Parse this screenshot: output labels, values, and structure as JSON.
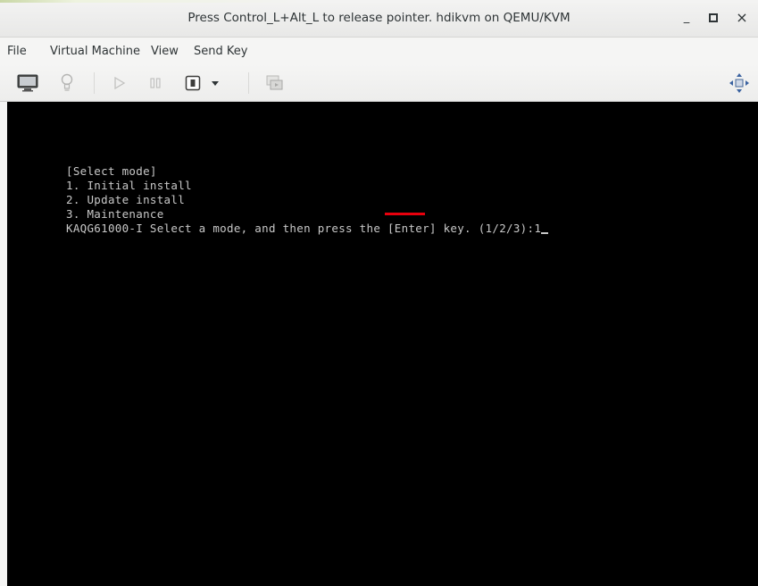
{
  "window": {
    "title": "Press Control_L+Alt_L to release pointer. hdikvm on QEMU/KVM",
    "minimize_label": "_",
    "maximize_label": "□",
    "close_label": "×"
  },
  "menubar": {
    "items": [
      {
        "label": "File"
      },
      {
        "label": "Virtual Machine"
      },
      {
        "label": "View"
      },
      {
        "label": "Send Key"
      }
    ]
  },
  "toolbar": {
    "buttons": [
      {
        "icon": "monitor-icon",
        "state": "active"
      },
      {
        "icon": "lightbulb-icon",
        "state": "disabled"
      },
      {
        "icon": "play-icon",
        "state": "disabled"
      },
      {
        "icon": "pause-icon",
        "state": "disabled"
      },
      {
        "icon": "power-icon",
        "state": "enabled"
      },
      {
        "icon": "chevron-down-icon",
        "state": "enabled"
      },
      {
        "icon": "snapshot-icon",
        "state": "disabled"
      },
      {
        "icon": "fullscreen-icon",
        "state": "enabled"
      }
    ]
  },
  "console": {
    "lines": [
      "[Select mode]",
      "1. Initial install",
      "2. Update install",
      "3. Maintenance",
      "KAQG61000-I Select a mode, and then press the [Enter] key. (1/2/3):1"
    ],
    "annotation_color": "#e8000d"
  },
  "colors": {
    "console_bg": "#000000",
    "console_text": "#c8c8c8",
    "chrome_bg": "#f5f5f4"
  }
}
